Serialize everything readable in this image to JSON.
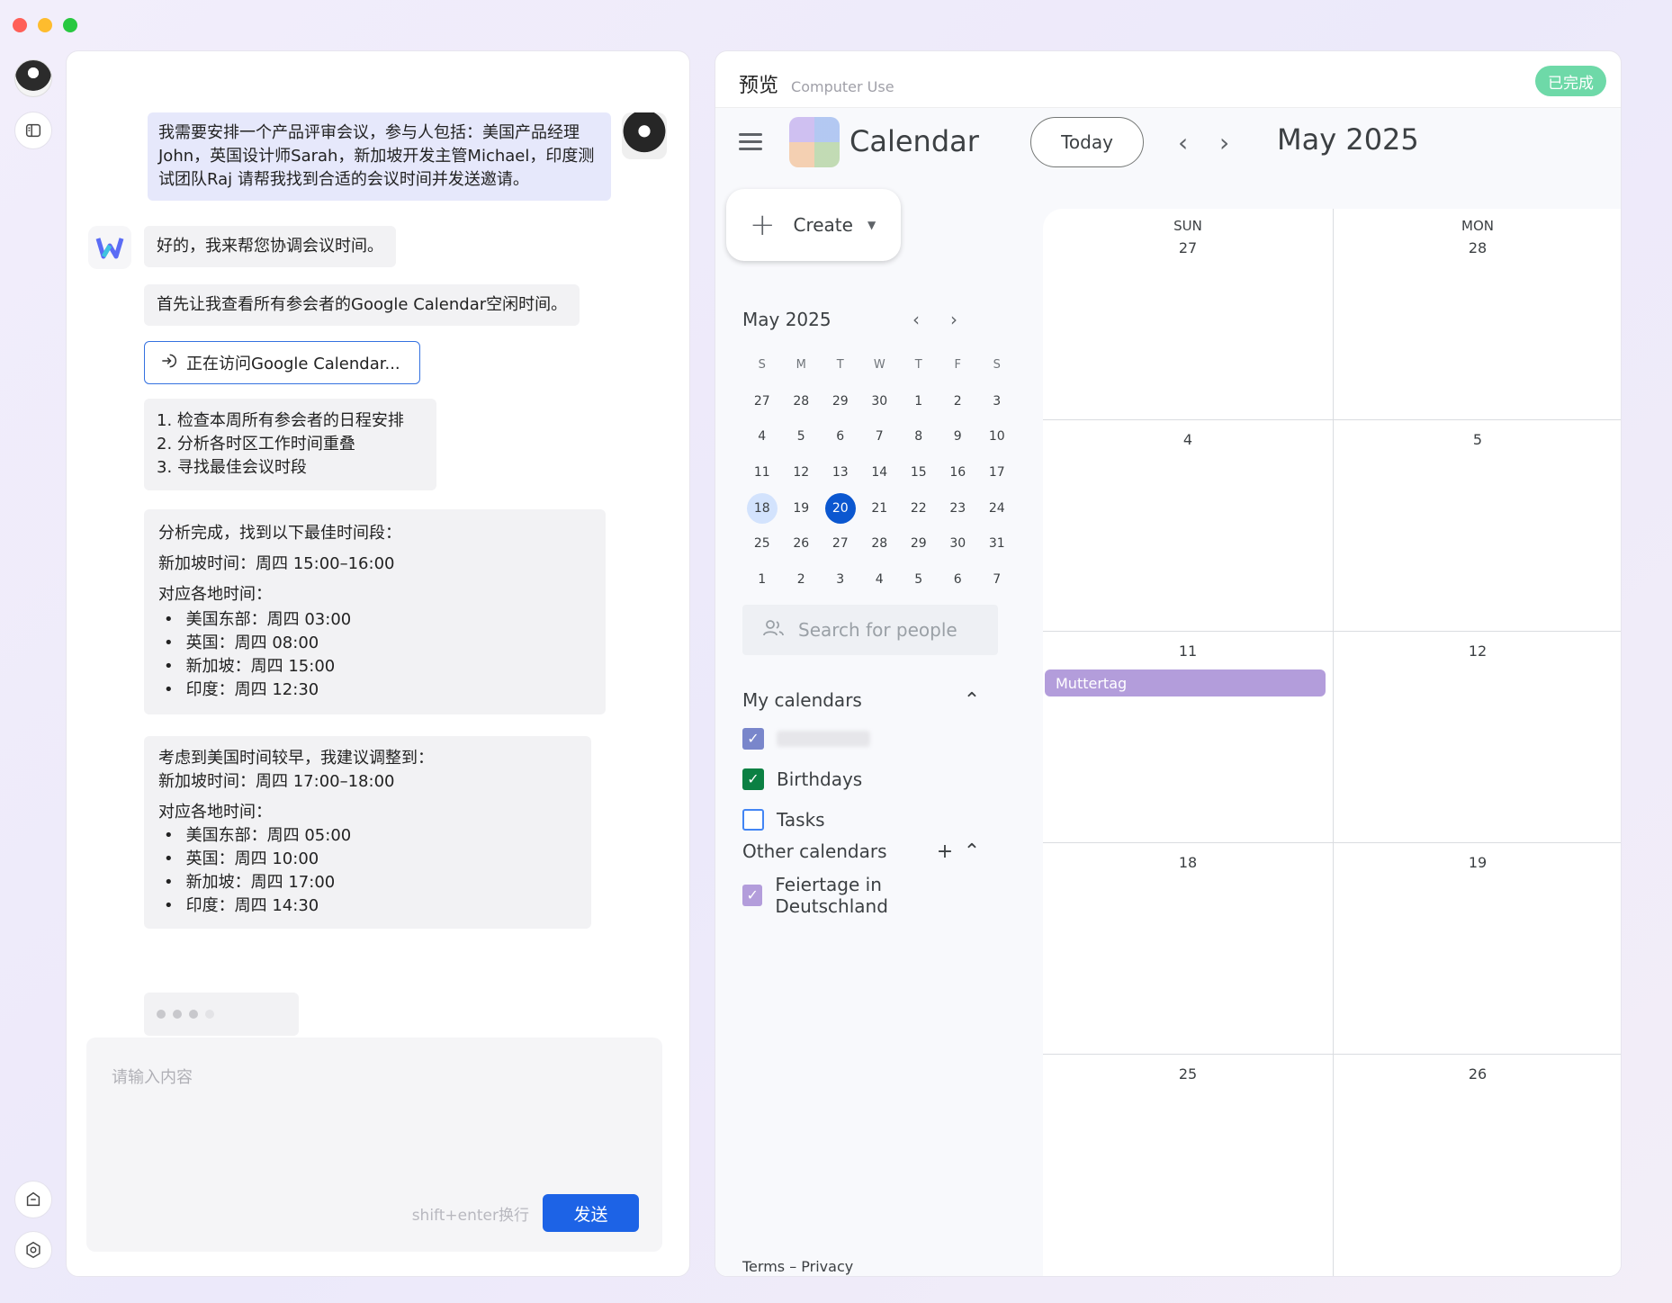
{
  "chat": {
    "user_message": "我需要安排一个产品评审会议，参与人包括：美国产品经理John，英国设计师Sarah，新加坡开发主管Michael，印度测试团队Raj 请帮我找到合适的会议时间并发送邀请。",
    "bot_reply_1": "好的，我来帮您协调会议时间。",
    "bot_reply_2": "首先让我查看所有参会者的Google Calendar空闲时间。",
    "tool_chip": "正在访问Google Calendar...",
    "steps": [
      "1. 检查本周所有参会者的日程安排",
      "2. 分析各时区工作时间重叠",
      "3. 寻找最佳会议时段"
    ],
    "analysis": {
      "heading": "分析完成，找到以下最佳时间段：",
      "singapore_time": "新加坡时间：周四 15:00–16:00",
      "local_heading": "对应各地时间：",
      "items": [
        "美国东部：周四 03:00",
        "英国：周四 08:00",
        "新加坡：周四 15:00",
        "印度：周四 12:30"
      ]
    },
    "proposal": {
      "heading": "考虑到美国时间较早，我建议调整到：",
      "singapore_time": "新加坡时间：周四 17:00–18:00",
      "local_heading": "对应各地时间：",
      "items": [
        "美国东部：周四 05:00",
        "英国：周四 10:00",
        "新加坡：周四 17:00",
        "印度：周四 14:30"
      ]
    },
    "input_placeholder": "请输入内容",
    "input_hint": "shift+enter换行",
    "send_label": "发送"
  },
  "preview": {
    "title": "预览",
    "subtitle": "Computer Use",
    "status_badge": "已完成",
    "status_color": "#6ed9a8"
  },
  "calendar": {
    "app_name": "Calendar",
    "today_label": "Today",
    "month_title": "May 2025",
    "create_label": "Create",
    "mini": {
      "title": "May 2025",
      "dow": [
        "S",
        "M",
        "T",
        "W",
        "T",
        "F",
        "S"
      ],
      "days": [
        "27",
        "28",
        "29",
        "30",
        "1",
        "2",
        "3",
        "4",
        "5",
        "6",
        "7",
        "8",
        "9",
        "10",
        "11",
        "12",
        "13",
        "14",
        "15",
        "16",
        "17",
        "18",
        "19",
        "20",
        "21",
        "22",
        "23",
        "24",
        "25",
        "26",
        "27",
        "28",
        "29",
        "30",
        "31",
        "1",
        "2",
        "3",
        "4",
        "5",
        "6",
        "7"
      ],
      "selected_day": "18",
      "current_day": "20"
    },
    "search_people_placeholder": "Search for people",
    "my_calendars_title": "My calendars",
    "my_calendars": [
      {
        "label": "",
        "checked": true,
        "color": "#7986cb"
      },
      {
        "label": "Birthdays",
        "checked": true,
        "color": "#0b8043"
      },
      {
        "label": "Tasks",
        "checked": false,
        "color": "#4285f4"
      }
    ],
    "other_calendars_title": "Other calendars",
    "other_calendars": [
      {
        "label": "Feiertage in Deutschland",
        "checked": true,
        "color": "#b39ddb"
      }
    ],
    "footer": "Terms – Privacy",
    "columns": [
      {
        "dow": "SUN",
        "day": "27"
      },
      {
        "dow": "MON",
        "day": "28"
      }
    ],
    "weeks": [
      [
        "4",
        "5"
      ],
      [
        "11",
        "12"
      ],
      [
        "18",
        "19"
      ],
      [
        "25",
        "26"
      ]
    ],
    "event": {
      "title": "Muttertag",
      "color": "#b39ddb"
    }
  }
}
